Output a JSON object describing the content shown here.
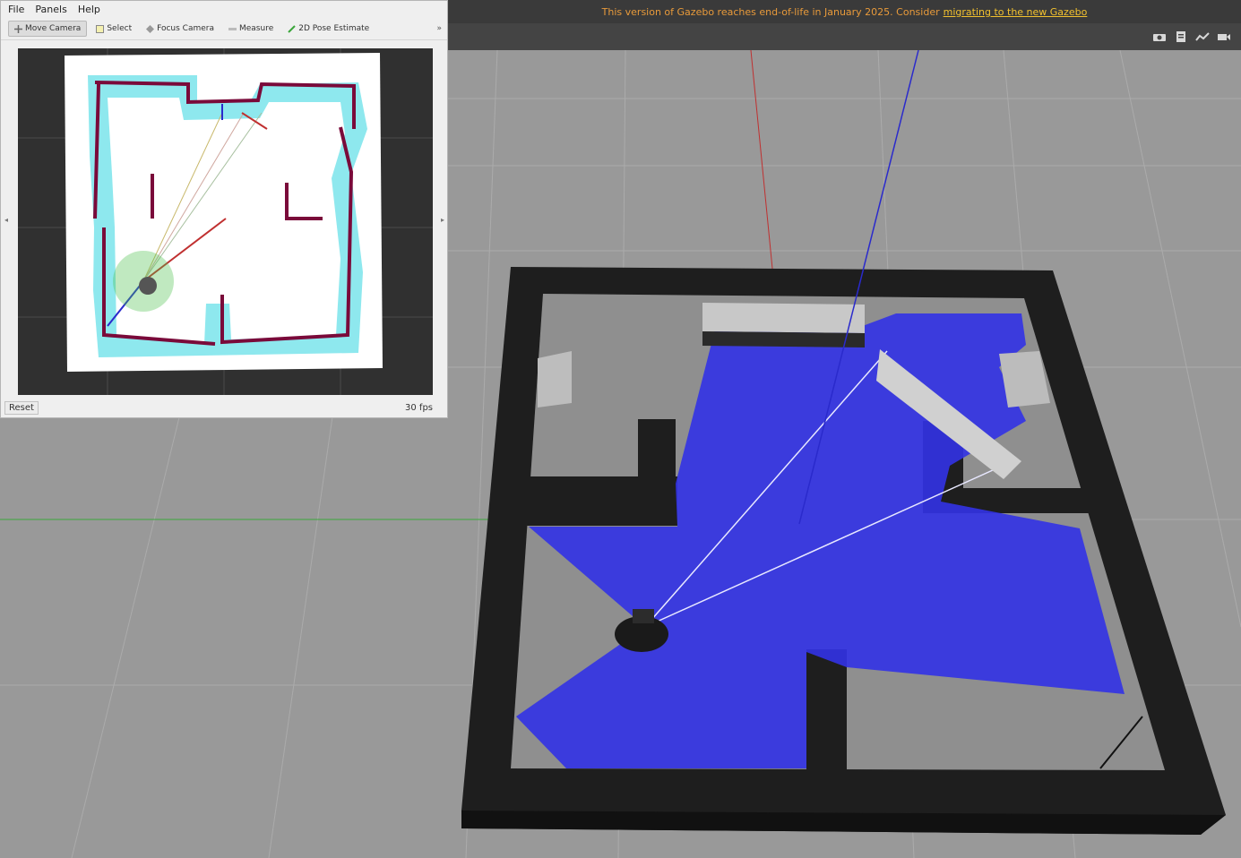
{
  "gazebo": {
    "banner_text": "This version of Gazebo reaches end-of-life in January 2025. Consider",
    "banner_link": "migrating to the new Gazebo",
    "toolbar_icons": [
      "camera-icon",
      "record-icon",
      "plot-icon",
      "video-icon"
    ]
  },
  "rviz": {
    "menu": [
      "File",
      "Panels",
      "Help"
    ],
    "tools": [
      {
        "label": "Move Camera",
        "icon": "move-camera-icon",
        "active": true
      },
      {
        "label": "Select",
        "icon": "select-icon",
        "active": false
      },
      {
        "label": "Focus Camera",
        "icon": "focus-camera-icon",
        "active": false
      },
      {
        "label": "Measure",
        "icon": "measure-icon",
        "active": false
      },
      {
        "label": "2D Pose Estimate",
        "icon": "pose-estimate-icon",
        "active": false
      }
    ],
    "more_glyph": "»",
    "reset_label": "Reset",
    "fps_label": "30 fps"
  },
  "colors": {
    "laser": "#3232e6",
    "wall": "#1e1e1e",
    "floor": "#8f8f8f",
    "costmap": "#8ee8ee",
    "obstacle": "#7a0a3a"
  }
}
